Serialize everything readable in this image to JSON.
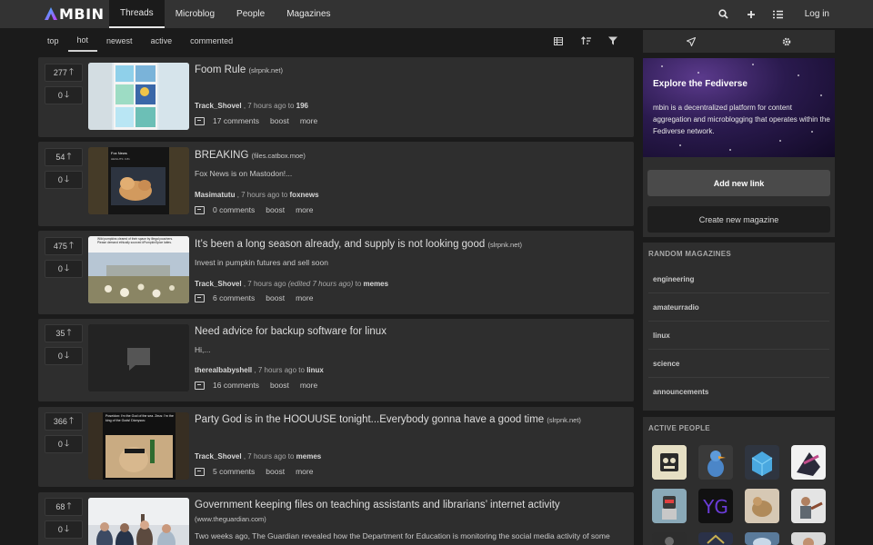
{
  "app": {
    "logo_text": "MBIN"
  },
  "nav": {
    "tabs": [
      {
        "label": "Threads",
        "active": true
      },
      {
        "label": "Microblog"
      },
      {
        "label": "People"
      },
      {
        "label": "Magazines"
      }
    ],
    "icons": [
      "search-icon",
      "plus-icon",
      "list-icon"
    ],
    "login_label": "Log in"
  },
  "sort": {
    "options": [
      "top",
      "hot",
      "newest",
      "active",
      "commented"
    ],
    "active": "hot",
    "tool_icons": [
      "view-icon",
      "sort-icon",
      "filter-icon"
    ]
  },
  "posts": [
    {
      "votes": "277",
      "title": "Foom Rule",
      "domain": "(slrpnk.net)",
      "body": "",
      "author": "Track_Shovel",
      "time": ", 7 hours ago to",
      "edited": "",
      "magazine": "196",
      "comments": "17 comments",
      "boost": "boost",
      "more": "more"
    },
    {
      "votes": "54",
      "title": "BREAKING",
      "domain": "(files.catbox.moe)",
      "body": "Fox News is on Mastodon!...",
      "author": "Masimatutu",
      "time": ", 7 hours ago to",
      "edited": "",
      "magazine": "foxnews",
      "comments": "0 comments",
      "boost": "boost",
      "more": "more"
    },
    {
      "votes": "475",
      "title": "It’s been a long season already, and supply is not looking good",
      "domain": "(slrpnk.net)",
      "body": "Invest in pumpkin futures and sell soon",
      "author": "Track_Shovel",
      "time": ", 7 hours ago",
      "edited": "(edited 7 hours ago)",
      "magazine": "memes",
      "comments": "6 comments",
      "boost": "boost",
      "more": "more"
    },
    {
      "votes": "35",
      "title": "Need advice for backup software for linux",
      "domain": "",
      "body": "Hi,...",
      "author": "therealbabyshell",
      "time": ", 7 hours ago to",
      "edited": "",
      "magazine": "linux",
      "comments": "16 comments",
      "boost": "boost",
      "more": "more"
    },
    {
      "votes": "366",
      "title": "Party God is in the HOOUUSE tonight...Everybody gonna have a good time",
      "domain": "(slrpnk.net)",
      "body": "",
      "author": "Track_Shovel",
      "time": ", 7 hours ago to",
      "edited": "",
      "magazine": "memes",
      "comments": "5 comments",
      "boost": "boost",
      "more": "more"
    },
    {
      "votes": "68",
      "title": "Government keeping files on teaching assistants and librarians’ internet activity",
      "domain": "(www.theguardian.com)",
      "body": "Two weeks ago, The Guardian revealed how the Department for Education is monitoring the social media activity of some"
    }
  ],
  "thumb_text": {
    "post2_header": "Fox News",
    "post2_line1": "HEIGHTS: 0.81",
    "post3_text": "Wild pumpkins cleared of their space by illegal poachers. Please demand ethically sourced #PumpkinSpice lattes.",
    "post5_text": "Poseidon: I'm the God of the sea. Zeus: I'm the king of the Gods! Dionysus:"
  },
  "sidebar": {
    "top_icons": [
      "send-icon",
      "gear-icon"
    ],
    "hero_title": "Explore the Fediverse",
    "hero_text": "mbin is a decentralized platform for content aggregation and microblogging that operates within the Fediverse network.",
    "add_link": "Add new link",
    "create_magazine": "Create new magazine",
    "random_magazines_title": "RANDOM MAGAZINES",
    "random_magazines": [
      "engineering",
      "amateurradio",
      "linux",
      "science",
      "announcements"
    ],
    "active_people_title": "ACTIVE PEOPLE",
    "avatar_text": "YG"
  },
  "colors": {
    "background": "#1b1b1b",
    "card": "#2e2e2e",
    "topbar": "#333333",
    "accent": "#7a3df0"
  }
}
